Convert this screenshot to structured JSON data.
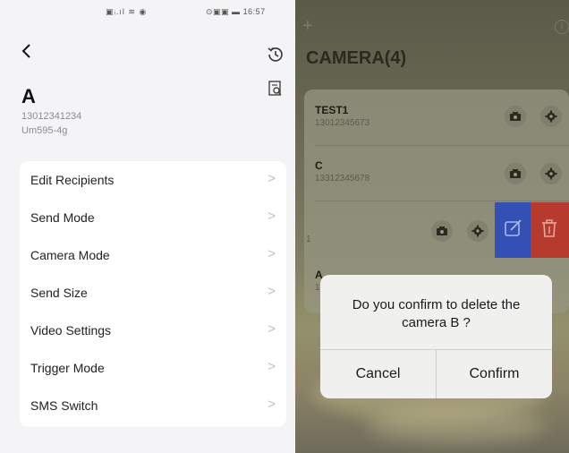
{
  "status_bar": {
    "signal_icons": "▣ᵢ.ıl ≋ ◉",
    "right_icons": "⊙▣▣ ▬",
    "time": "16:57"
  },
  "left": {
    "device": {
      "name": "A",
      "phone": "13012341234",
      "model": "Um595-4g"
    },
    "menu": [
      {
        "label": "Edit Recipients"
      },
      {
        "label": "Send Mode"
      },
      {
        "label": "Camera Mode"
      },
      {
        "label": "Send Size"
      },
      {
        "label": "Video Settings"
      },
      {
        "label": "Trigger Mode"
      },
      {
        "label": "SMS Switch"
      }
    ],
    "chevron": ">"
  },
  "right": {
    "plus": "+",
    "info": "i",
    "title": "CAMERA(4)",
    "cameras": [
      {
        "name": "TEST1",
        "number": "13012345673"
      },
      {
        "name": "C",
        "number": "13312345678"
      },
      {
        "name": "",
        "number": "1"
      },
      {
        "name": "A",
        "number": "1"
      }
    ],
    "dialog": {
      "message": "Do you confirm to delete the camera B ?",
      "cancel": "Cancel",
      "confirm": "Confirm"
    }
  },
  "colors": {
    "edit": "#3450b4",
    "delete": "#b63a2e"
  },
  "icons": [
    "back-icon",
    "history-icon",
    "document-search-icon",
    "plus-icon",
    "info-icon",
    "camera-icon",
    "gear-icon",
    "edit-icon",
    "trash-icon"
  ]
}
